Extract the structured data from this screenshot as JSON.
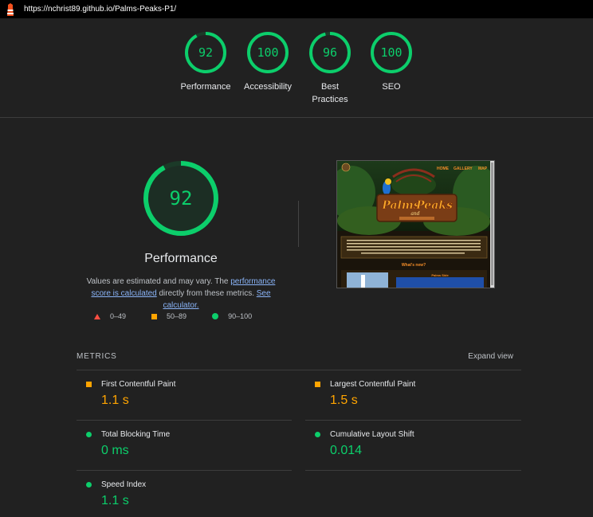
{
  "topbar": {
    "url": "https://nchrist89.github.io/Palms-Peaks-P1/"
  },
  "summary": [
    {
      "score": "92",
      "label": "Performance"
    },
    {
      "score": "100",
      "label": "Accessibility"
    },
    {
      "score": "96",
      "label": "Best Practices"
    },
    {
      "score": "100",
      "label": "SEO"
    }
  ],
  "performance": {
    "score": "92",
    "title": "Performance",
    "desc_prefix": "Values are estimated and may vary. The ",
    "desc_link1": "performance score is calculated",
    "desc_middle": " directly from these metrics. ",
    "desc_link2": "See calculator."
  },
  "legend": {
    "fail": "0–49",
    "average": "50–89",
    "pass": "90–100"
  },
  "screenshot": {
    "nav": [
      "HOME",
      "GALLERY",
      "MAP"
    ],
    "logo_line1": "Palms",
    "logo_and": "and",
    "logo_line2": "Peaks",
    "section_title": "What's new?",
    "card_title": "Palms Side"
  },
  "metrics": {
    "title": "METRICS",
    "expand": "Expand view",
    "fcp": {
      "name": "First Contentful Paint",
      "value": "1.1 s"
    },
    "lcp": {
      "name": "Largest Contentful Paint",
      "value": "1.5 s"
    },
    "tbt": {
      "name": "Total Blocking Time",
      "value": "0 ms"
    },
    "cls": {
      "name": "Cumulative Layout Shift",
      "value": "0.014"
    },
    "si": {
      "name": "Speed Index",
      "value": "1.1 s"
    }
  },
  "colors": {
    "pass": "#0cce6b",
    "average": "#ffa400",
    "fail": "#ff4e42",
    "background": "#212121"
  }
}
